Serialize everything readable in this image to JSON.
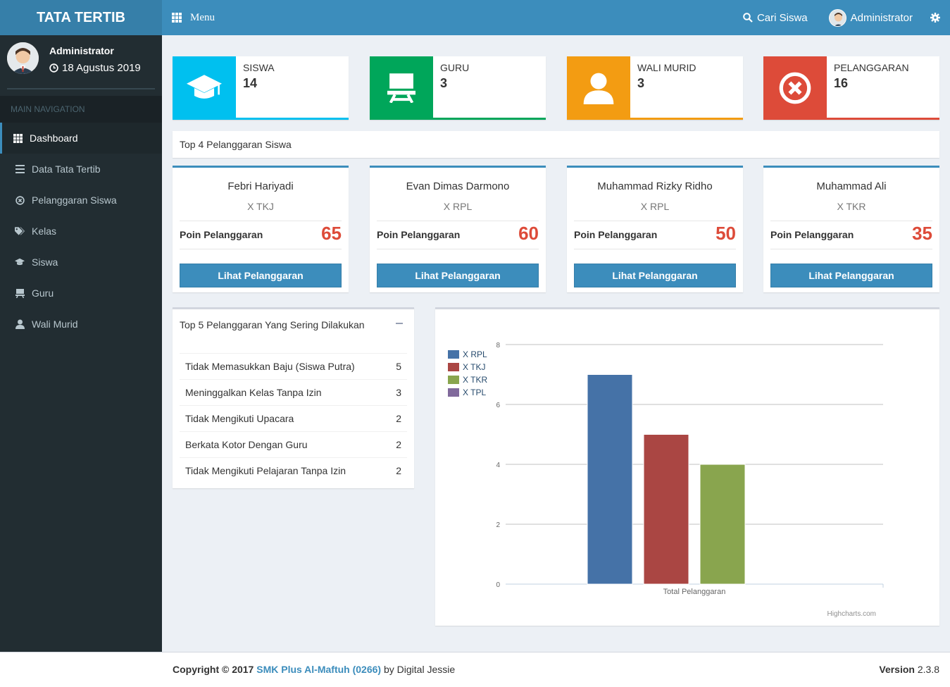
{
  "header": {
    "logo": "TATA TERTIB",
    "menu_label": "Menu",
    "search_label": "Cari Siswa",
    "user_label": "Administrator"
  },
  "sidebar": {
    "user_name": "Administrator",
    "date": "18 Agustus 2019",
    "nav_header": "MAIN NAVIGATION",
    "items": [
      {
        "label": "Dashboard",
        "icon": "dashboard-icon"
      },
      {
        "label": "Data Tata Tertib",
        "icon": "list-icon"
      },
      {
        "label": "Pelanggaran Siswa",
        "icon": "times-circle-icon"
      },
      {
        "label": "Kelas",
        "icon": "tags-icon"
      },
      {
        "label": "Siswa",
        "icon": "graduation-cap-icon"
      },
      {
        "label": "Guru",
        "icon": "desk-icon"
      },
      {
        "label": "Wali Murid",
        "icon": "user-icon"
      }
    ]
  },
  "info_boxes": [
    {
      "label": "SISWA",
      "value": "14",
      "color": "#00c0ef",
      "icon": "graduation-cap-icon"
    },
    {
      "label": "GURU",
      "value": "3",
      "color": "#00a65a",
      "icon": "desk-icon"
    },
    {
      "label": "WALI MURID",
      "value": "3",
      "color": "#f39c12",
      "icon": "user-icon"
    },
    {
      "label": "PELANGGARAN",
      "value": "16",
      "color": "#dd4b39",
      "icon": "times-circle-icon"
    }
  ],
  "top4": {
    "title": "Top 4 Pelanggaran Siswa",
    "points_label": "Poin Pelanggaran",
    "button_label": "Lihat Pelanggaran",
    "students": [
      {
        "name": "Febri Hariyadi",
        "class": "X TKJ",
        "points": "65"
      },
      {
        "name": "Evan Dimas Darmono",
        "class": "X RPL",
        "points": "60"
      },
      {
        "name": "Muhammad Rizky Ridho",
        "class": "X RPL",
        "points": "50"
      },
      {
        "name": "Muhammad Ali",
        "class": "X TKR",
        "points": "35"
      }
    ]
  },
  "top5": {
    "title": "Top 5 Pelanggaran Yang Sering Dilakukan",
    "rows": [
      {
        "label": "Tidak Memasukkan Baju (Siswa Putra)",
        "count": "5"
      },
      {
        "label": "Meninggalkan Kelas Tanpa Izin",
        "count": "3"
      },
      {
        "label": "Tidak Mengikuti Upacara",
        "count": "2"
      },
      {
        "label": "Berkata Kotor Dengan Guru",
        "count": "2"
      },
      {
        "label": "Tidak Mengikuti Pelajaran Tanpa Izin",
        "count": "2"
      }
    ]
  },
  "chart_data": {
    "type": "bar",
    "categories": [
      "Total Pelanggaran"
    ],
    "series": [
      {
        "name": "X RPL",
        "values": [
          7
        ],
        "color": "#4572a7"
      },
      {
        "name": "X TKJ",
        "values": [
          5
        ],
        "color": "#aa4643"
      },
      {
        "name": "X TKR",
        "values": [
          4
        ],
        "color": "#89a54e"
      },
      {
        "name": "X TPL",
        "values": [
          0
        ],
        "color": "#80699b"
      }
    ],
    "yticks": [
      "0",
      "2",
      "4",
      "6",
      "8"
    ],
    "ylim": [
      0,
      8
    ],
    "grid": true,
    "legend": "top-left",
    "credits": "Highcharts.com"
  },
  "footer": {
    "copyright": "Copyright © 2017",
    "school": "SMK Plus Al-Maftuh (0266)",
    "by": "by Digital Jessie",
    "version_label": "Version",
    "version": "2.3.8"
  }
}
